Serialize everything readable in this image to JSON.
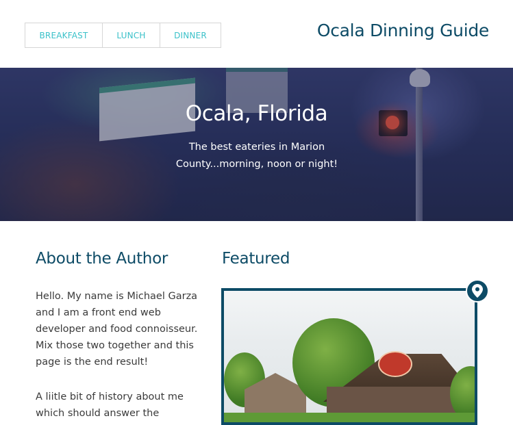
{
  "nav": {
    "items": [
      {
        "label": "BREAKFAST"
      },
      {
        "label": "LUNCH"
      },
      {
        "label": "DINNER"
      }
    ]
  },
  "header": {
    "site_title": "Ocala Dinning Guide"
  },
  "hero": {
    "title": "Ocala, Florida",
    "tagline": "The best eateries in Marion County...morning, noon or night!"
  },
  "about": {
    "heading": "About the Author",
    "paragraph_1": "Hello. My name is Michael Garza and I am a front end web developer and food connoisseur. Mix those two together and this page is the end result!",
    "paragraph_2": "A liitle bit of history about me which should answer the"
  },
  "featured": {
    "heading": "Featured",
    "pin_icon": "map-pin-icon"
  },
  "colors": {
    "accent": "#3ac1c9",
    "brand": "#0d4b66",
    "hero_overlay": "#2c3a5e"
  }
}
